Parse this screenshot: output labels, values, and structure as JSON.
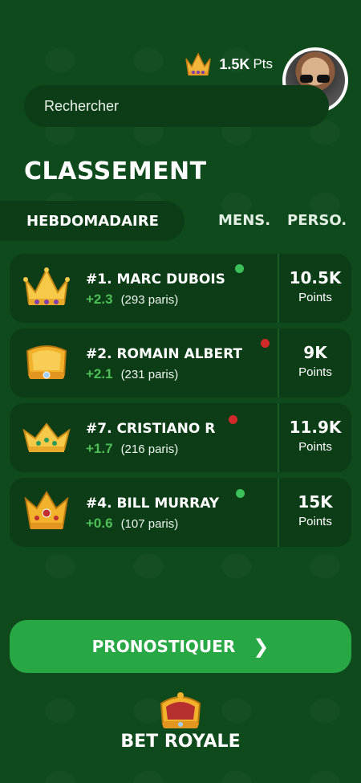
{
  "header": {
    "points_value": "1.5K",
    "points_unit": "Pts",
    "avatar": "user-avatar-photo"
  },
  "search": {
    "placeholder": "Rechercher"
  },
  "leaderboard": {
    "title": "CLASSEMENT",
    "tabs": {
      "active": "HEBDOMADAIRE",
      "monthly": "MENS.",
      "personal": "PERSO."
    },
    "rows": [
      {
        "rank_name": "#1. MARC DUBOIS",
        "delta": "+2.3",
        "bets": "(293 paris)",
        "score": "10.5K",
        "score_label": "Points",
        "status_color": "#3cc05a",
        "crown": "crown-purple-icon"
      },
      {
        "rank_name": "#2. ROMAIN ALBERT",
        "delta": "+2.1",
        "bets": "(231 paris)",
        "score": "9K",
        "score_label": "Points",
        "status_color": "#d22a2a",
        "crown": "crown-blue-jewel-icon"
      },
      {
        "rank_name": "#7. CRISTIANO R",
        "delta": "+1.7",
        "bets": "(216 paris)",
        "score": "11.9K",
        "score_label": "Points",
        "status_color": "#d22a2a",
        "crown": "crown-green-jewel-icon"
      },
      {
        "rank_name": "#4. BILL MURRAY",
        "delta": "+0.6",
        "bets": "(107 paris)",
        "score": "15K",
        "score_label": "Points",
        "status_color": "#3cc05a",
        "crown": "crown-red-jewel-icon"
      }
    ]
  },
  "cta": {
    "label": "PRONOSTIQUER",
    "icon": "chevron-right-icon"
  },
  "brand": {
    "name": "BET ROYALE"
  },
  "colors": {
    "background": "#0f4a1d",
    "card": "#0c3d17",
    "accent": "#28a745",
    "delta": "#4dbf57"
  }
}
